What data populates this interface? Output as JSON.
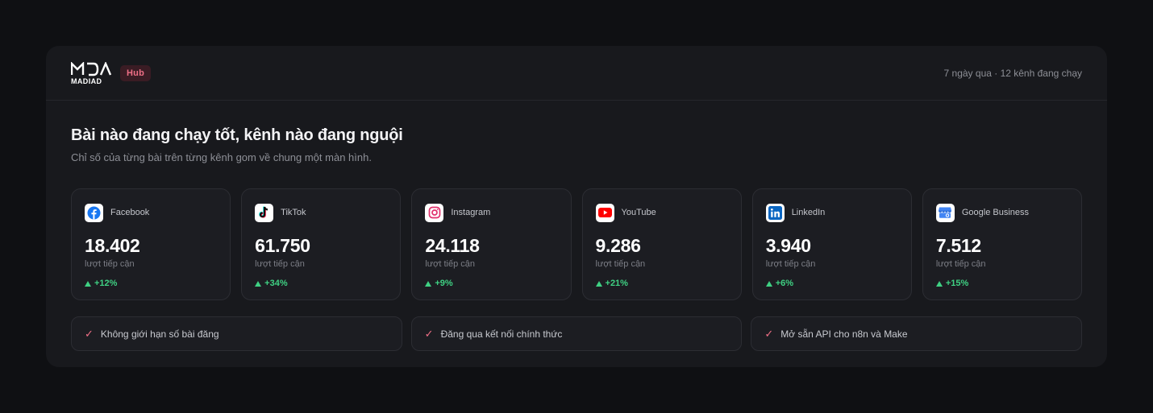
{
  "header": {
    "logo_text": "MADIAD",
    "badge": "Hub",
    "period": "7 ngày qua · 12 kênh đang chạy"
  },
  "main": {
    "title": "Bài nào đang chạy tốt, kênh nào đang nguội",
    "subtitle": "Chỉ số của từng bài trên từng kênh gom về chung một màn hình."
  },
  "channels": [
    {
      "name": "Facebook",
      "value": "18.402",
      "label": "lượt tiếp cận",
      "delta": "+12%",
      "icon": "facebook-icon"
    },
    {
      "name": "TikTok",
      "value": "61.750",
      "label": "lượt tiếp cận",
      "delta": "+34%",
      "icon": "tiktok-icon"
    },
    {
      "name": "Instagram",
      "value": "24.118",
      "label": "lượt tiếp cận",
      "delta": "+9%",
      "icon": "instagram-icon"
    },
    {
      "name": "YouTube",
      "value": "9.286",
      "label": "lượt tiếp cận",
      "delta": "+21%",
      "icon": "youtube-icon"
    },
    {
      "name": "LinkedIn",
      "value": "3.940",
      "label": "lượt tiếp cận",
      "delta": "+6%",
      "icon": "linkedin-icon"
    },
    {
      "name": "Google Business",
      "value": "7.512",
      "label": "lượt tiếp cận",
      "delta": "+15%",
      "icon": "google-business-icon"
    }
  ],
  "features": [
    {
      "text": "Không giới hạn số bài đăng"
    },
    {
      "text": "Đăng qua kết nối chính thức"
    },
    {
      "text": "Mở sẵn API cho n8n và Make"
    }
  ],
  "colors": {
    "accent": "#ef6f86",
    "positive": "#3fd183",
    "card_bg": "#18191d",
    "page_bg": "#0f1013"
  }
}
